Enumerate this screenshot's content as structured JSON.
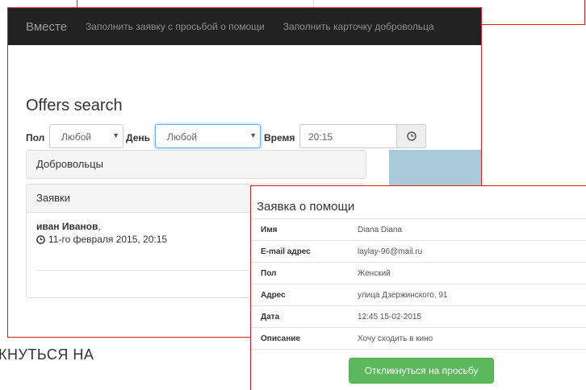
{
  "navbar": {
    "brand": "Вместе",
    "links": [
      "Заполнить заявку с просьбой о помощи",
      "Заполнить карточку добровольца"
    ]
  },
  "page": {
    "title": "Offers search"
  },
  "filters": {
    "sex_label": "Пол",
    "sex_value": "Любой",
    "day_label": "День",
    "day_value": "Любой",
    "time_label": "Время",
    "time_value": "20:15"
  },
  "panels": {
    "volunteers_heading": "Добровольцы",
    "requests_heading": "Заявки",
    "request_item": {
      "name": "иван Иванов",
      "date": "11-го февраля 2015, 20:15"
    }
  },
  "modal": {
    "title": "Заявка о помощи",
    "rows": [
      {
        "label": "Имя",
        "value": "Diana Diana"
      },
      {
        "label": "E-mail адрес",
        "value": "laylay-96@mail.ru"
      },
      {
        "label": "Пол",
        "value": "Женский"
      },
      {
        "label": "Адрес",
        "value": "улица Дзержинского, 91"
      },
      {
        "label": "Дата",
        "value": "12:45 15-02-2015"
      },
      {
        "label": "Описание",
        "value": "Хочу сходить в кино"
      }
    ],
    "respond_button": "Откликнуться на просьбу"
  },
  "background_text": "КНУТЬСЯ НА",
  "colors": {
    "navbar_bg": "#222222",
    "accent_green": "#5cb85c",
    "annotation_red": "#e02020",
    "map_blue": "#a9cad8"
  }
}
